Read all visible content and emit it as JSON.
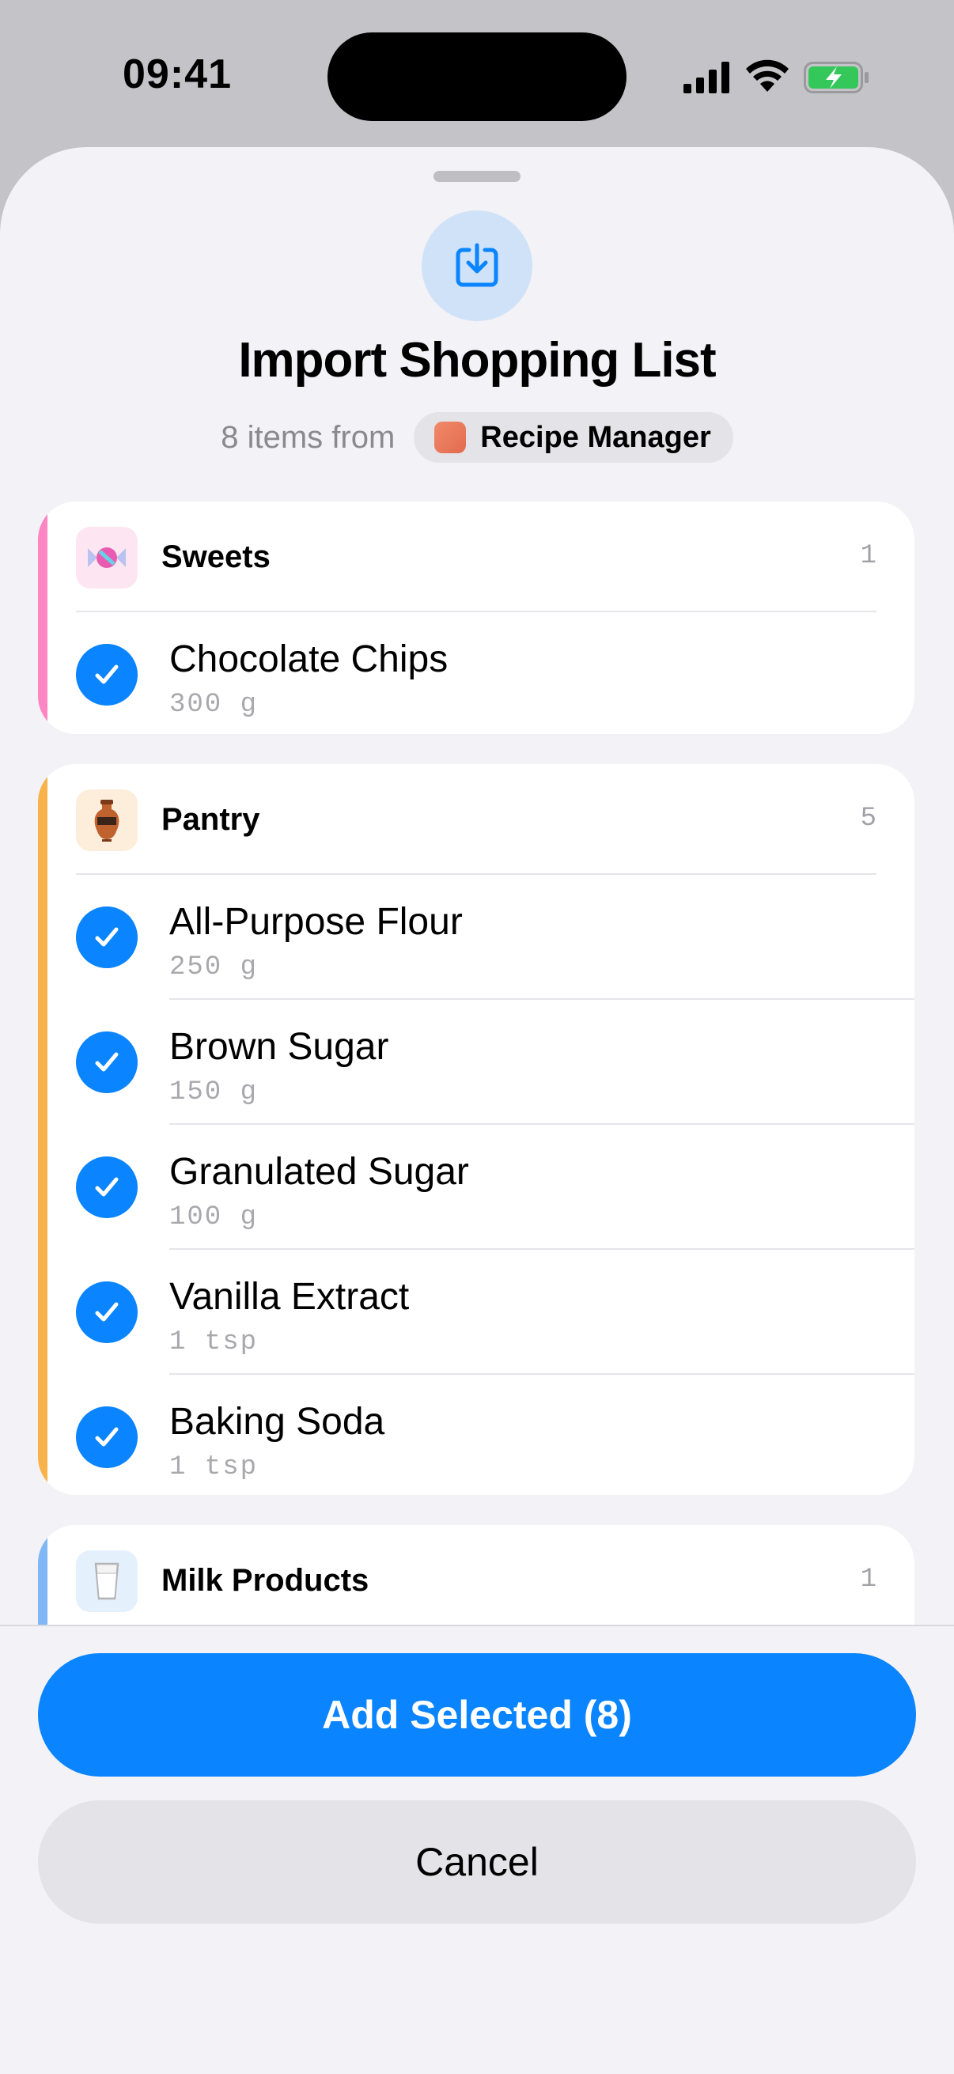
{
  "status_bar": {
    "time": "09:41",
    "icons": [
      "cellular-signal-icon",
      "wifi-icon",
      "battery-charging-icon"
    ]
  },
  "sheet": {
    "header_icon": "import-tray-icon",
    "title": "Import Shopping List",
    "subtitle": "8 items from",
    "source_app": {
      "name": "Recipe Manager",
      "icon": "recipe-manager-app-icon"
    }
  },
  "categories": [
    {
      "name": "Sweets",
      "count": "1",
      "icon": "candy",
      "accent": "#ff86c2",
      "icon_bg": "#fde6f1",
      "items": [
        {
          "name": "Chocolate Chips",
          "qty": "300 g",
          "checked": true
        }
      ]
    },
    {
      "name": "Pantry",
      "count": "5",
      "icon": "amphora",
      "accent": "#f8b24a",
      "icon_bg": "#fdeedb",
      "items": [
        {
          "name": "All-Purpose Flour",
          "qty": "250 g",
          "checked": true
        },
        {
          "name": "Brown Sugar",
          "qty": "150 g",
          "checked": true
        },
        {
          "name": "Granulated Sugar",
          "qty": "100 g",
          "checked": true
        },
        {
          "name": "Vanilla Extract",
          "qty": "1 tsp",
          "checked": true
        },
        {
          "name": "Baking Soda",
          "qty": "1 tsp",
          "checked": true
        }
      ]
    },
    {
      "name": "Milk Products",
      "count": "1",
      "icon": "milk-glass",
      "accent": "#7fb8f5",
      "icon_bg": "#e4f0fc",
      "items": []
    }
  ],
  "actions": {
    "primary": "Add Selected (8)",
    "secondary": "Cancel"
  },
  "colors": {
    "accent_blue": "#0a84ff",
    "sheet_bg": "#f2f2f7"
  }
}
